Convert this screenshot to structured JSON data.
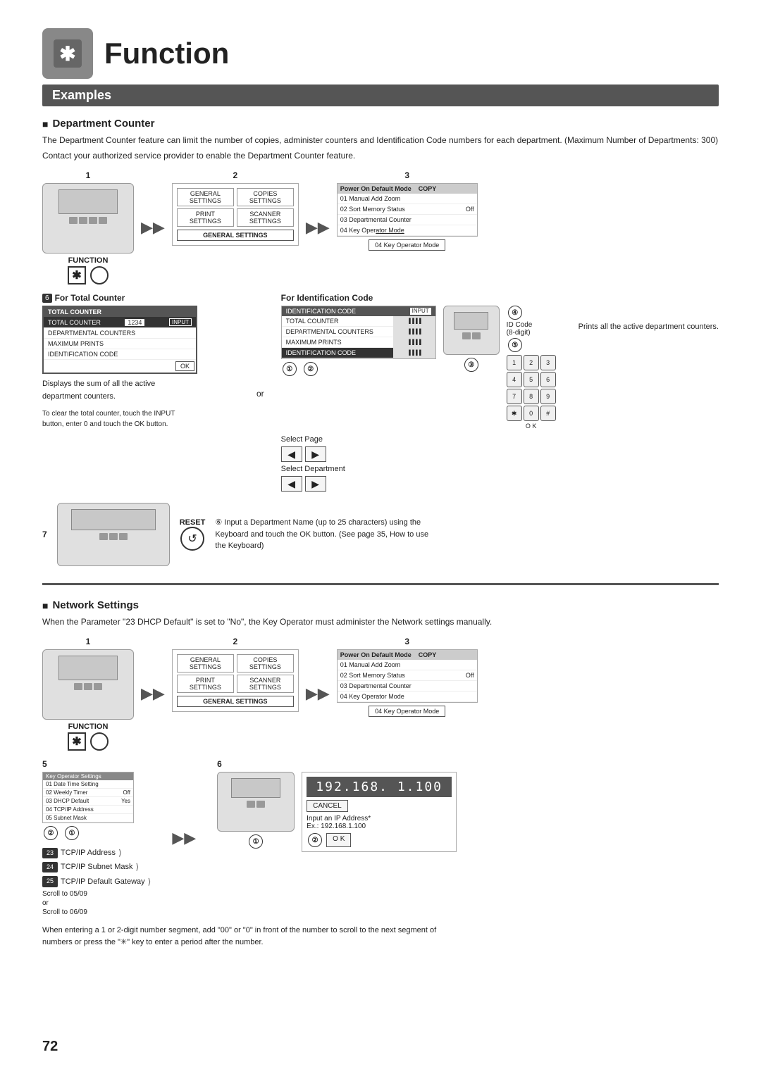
{
  "page": {
    "number": "72",
    "title": "Function",
    "section": "Examples"
  },
  "dept_counter": {
    "title": "Department Counter",
    "body1": "The Department Counter feature can limit the number of copies, administer counters and Identification Code numbers for each department. (Maximum Number of Departments: 300)",
    "body2": "Contact your authorized service provider to enable the Department Counter feature.",
    "step1_label": "1",
    "step2_label": "2",
    "step3_label": "3",
    "function_text": "FUNCTION",
    "gen_settings": "GENERAL SETTINGS",
    "key_operator": "04  Key Operator Mode",
    "step6_for_total": "For Total Counter",
    "step6_for_id": "For Identification Code",
    "total_counter_label": "TOTAL COUNTER",
    "tc_rows": [
      "TOTAL COUNTER",
      "DEPARTMENTAL COUNTERS",
      "MAXIMUM PRINTS",
      "IDENTIFICATION CODE"
    ],
    "tc_input": "1234",
    "tc_input_btn": "INPUT",
    "ok_btn": "OK",
    "desc1": "Displays the sum of  all the active department counters.",
    "desc2": "Prints all the active department counters.",
    "clear_note": "To clear the total counter, touch the INPUT button, enter 0 and touch the OK button.",
    "id_code_label": "IDENTIFICATION CODE",
    "id_input_label": "INPUT",
    "id_rows": [
      "TOTAL COUNTER",
      "DEPARTMENTAL COUNTERS",
      "MAXIMUM PRINTS",
      "IDENTIFICATION CODE"
    ],
    "select_page": "Select Page",
    "select_dept": "Select Department",
    "id_code_digit": "ID Code\n(8-digit)",
    "keypad_keys": [
      "1",
      "2",
      "3",
      "4",
      "5",
      "6",
      "7",
      "8",
      "9",
      "*",
      "0",
      "#"
    ],
    "step7_label": "7",
    "reset_label": "RESET",
    "id_code_note": "⑥ Input a Department Name (up to 25 characters) using the Keyboard and touch the OK button. (See page 35, How to use the Keyboard)",
    "step_circles": [
      "①",
      "②",
      "③",
      "④",
      "⑤"
    ]
  },
  "network": {
    "title": "Network Settings",
    "body": "When the Parameter \"23 DHCP Default\" is set to \"No\", the Key Operator must administer the Network settings manually.",
    "step1_label": "1",
    "step2_label": "2",
    "step3_label": "3",
    "function_text": "FUNCTION",
    "gen_settings": "GENERAL SETTINGS",
    "key_operator": "04  Key Operator Mode",
    "step5_label": "5",
    "step6_label": "6",
    "menu_rows": [
      {
        "num": "01",
        "label": "Date Time Setting"
      },
      {
        "num": "02",
        "label": "Weekly Timer"
      },
      {
        "num": "03",
        "label": "DHCP Default"
      },
      {
        "num": "04",
        "label": "TCP/IP Address"
      },
      {
        "num": "05",
        "label": "Subnet Mask"
      }
    ],
    "menu_row_values": [
      "",
      "Off",
      "Yes",
      "",
      ""
    ],
    "step_circle_1": "②",
    "step_circle_2": "①",
    "tcp_items": [
      {
        "num": "23",
        "label": "TCP/IP Address"
      },
      {
        "num": "24",
        "label": "TCP/IP Subnet Mask"
      },
      {
        "num": "25",
        "label": "TCP/IP Default Gateway"
      }
    ],
    "scroll_note1": "Scroll to 05/09",
    "scroll_note2": "or",
    "scroll_note3": "Scroll to 06/09",
    "ip_display": "192.168. 1.100",
    "input_label": "Input an IP Address*",
    "ip_example": "Ex.: 192.168.1.100",
    "ok_btn": "O K",
    "cancel_btn": "CANCEL",
    "arrow_label_1": "►",
    "step_circle_3": "②",
    "step_circle_4": "①",
    "bottom_note": "When entering a 1 or 2-digit number segment, add \"00\" or \"0\" in front of the number to scroll to the next segment of numbers or press the \"✳\" key to enter a period after the number."
  },
  "icons": {
    "asterisk": "✱",
    "arrow_right_double": "▶▶",
    "arrow_left": "◀",
    "arrow_right": "▶",
    "reset_symbol": "↺"
  }
}
